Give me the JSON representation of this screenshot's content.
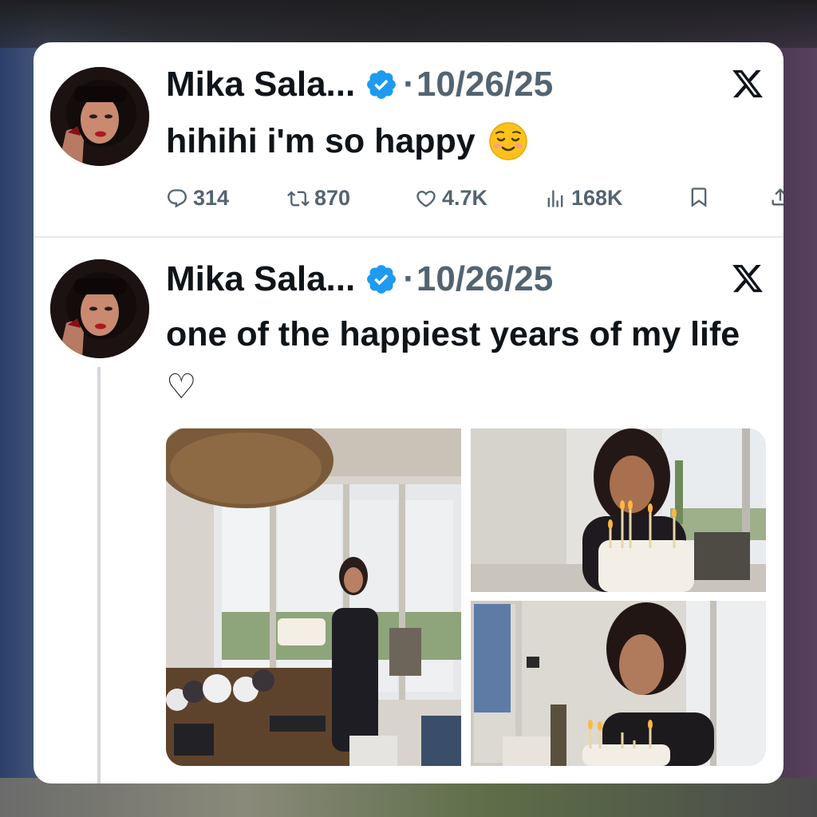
{
  "tweets": [
    {
      "author": "Mika Sala...",
      "separator": "·",
      "date": "10/26/25",
      "text": "hihihi i'm so happy",
      "emoji": "relieved-smile-emoji",
      "stats": {
        "replies": "314",
        "reposts": "870",
        "likes": "4.7K",
        "views": "168K"
      }
    },
    {
      "author": "Mika Sala...",
      "separator": "·",
      "date": "10/26/25",
      "text": "one of the happiest years of my life",
      "heart": "♡",
      "photos": [
        "birthday-cake-room-photo",
        "candles-cake-photo",
        "blowing-candles-photo"
      ]
    }
  ],
  "colors": {
    "verified": "#1d9bf0",
    "text": "#0f1419",
    "muted": "#536471"
  },
  "icons": [
    "verified-badge-icon",
    "x-logo-icon",
    "reply-icon",
    "repost-icon",
    "like-icon",
    "views-icon",
    "bookmark-icon",
    "share-icon"
  ]
}
